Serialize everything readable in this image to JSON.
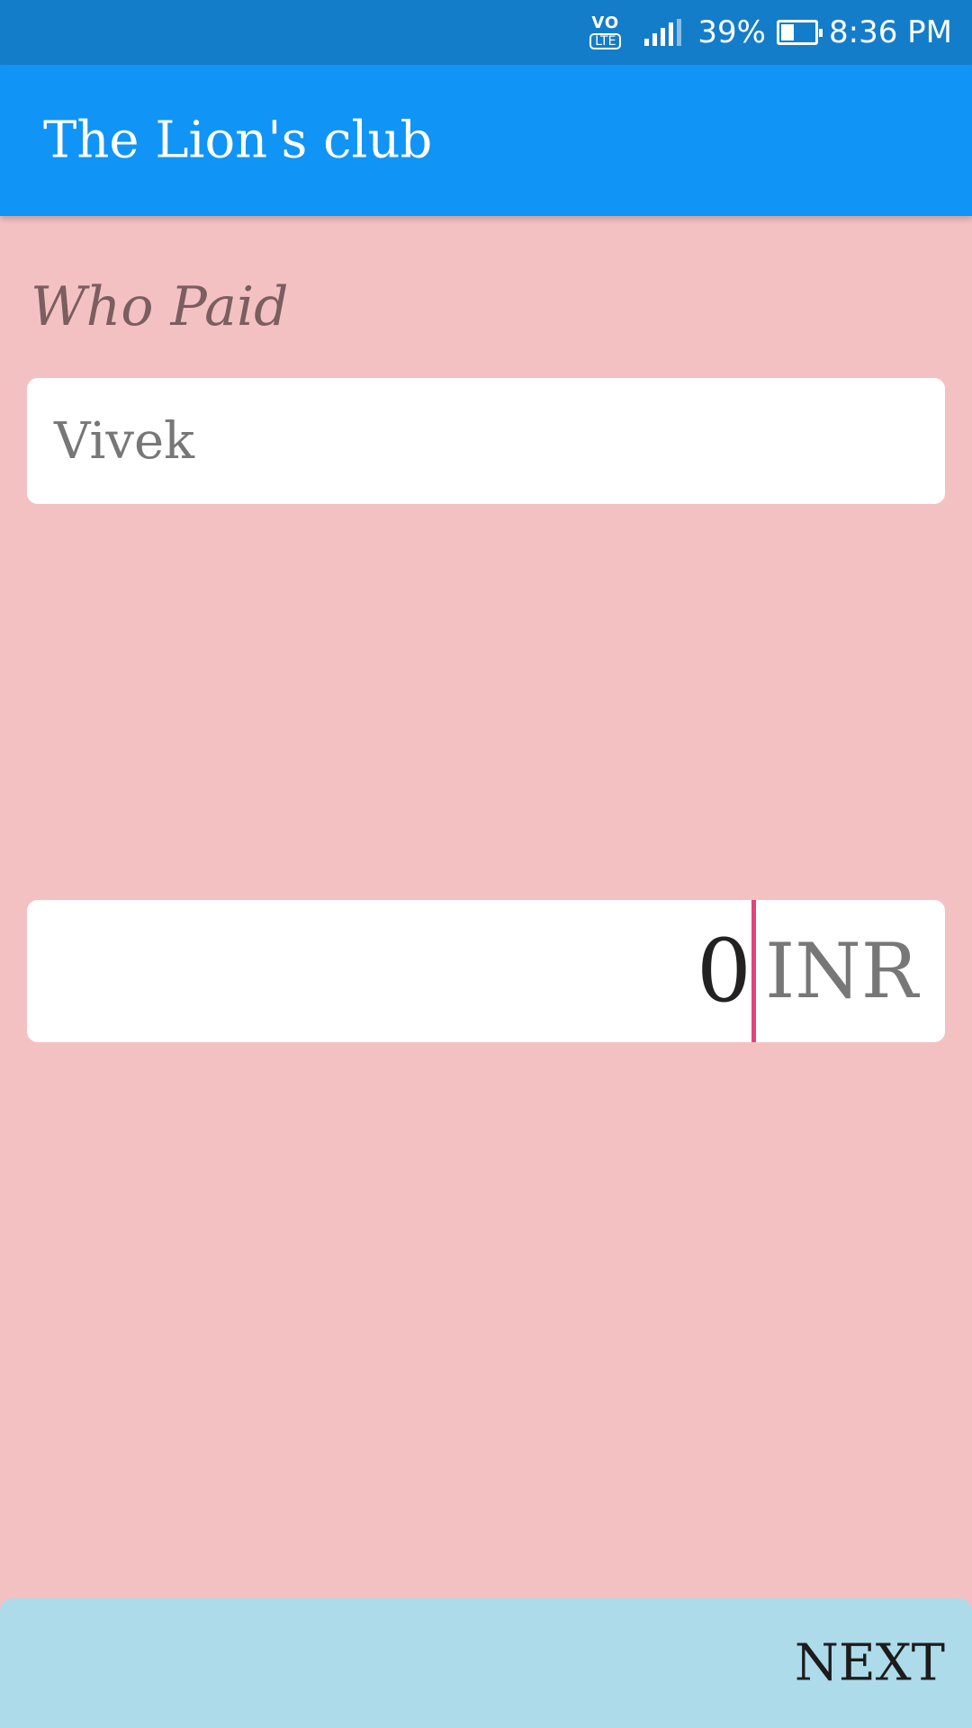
{
  "status_bar": {
    "network_label": "VO",
    "network_sub": "LTE",
    "battery_percent": "39%",
    "battery_level": 0.39,
    "time": "8:36 PM"
  },
  "app_bar": {
    "title": "The Lion's club",
    "color": "#1094f6"
  },
  "form": {
    "who_paid_label": "Who Paid",
    "payer_value": "Vivek",
    "amount_value": "0",
    "currency": "INR"
  },
  "footer": {
    "next_label": "NEXT",
    "color": "#addbea"
  },
  "colors": {
    "background": "#f4c1c3",
    "status_bar": "#147dc9",
    "cursor": "#e0457b"
  }
}
